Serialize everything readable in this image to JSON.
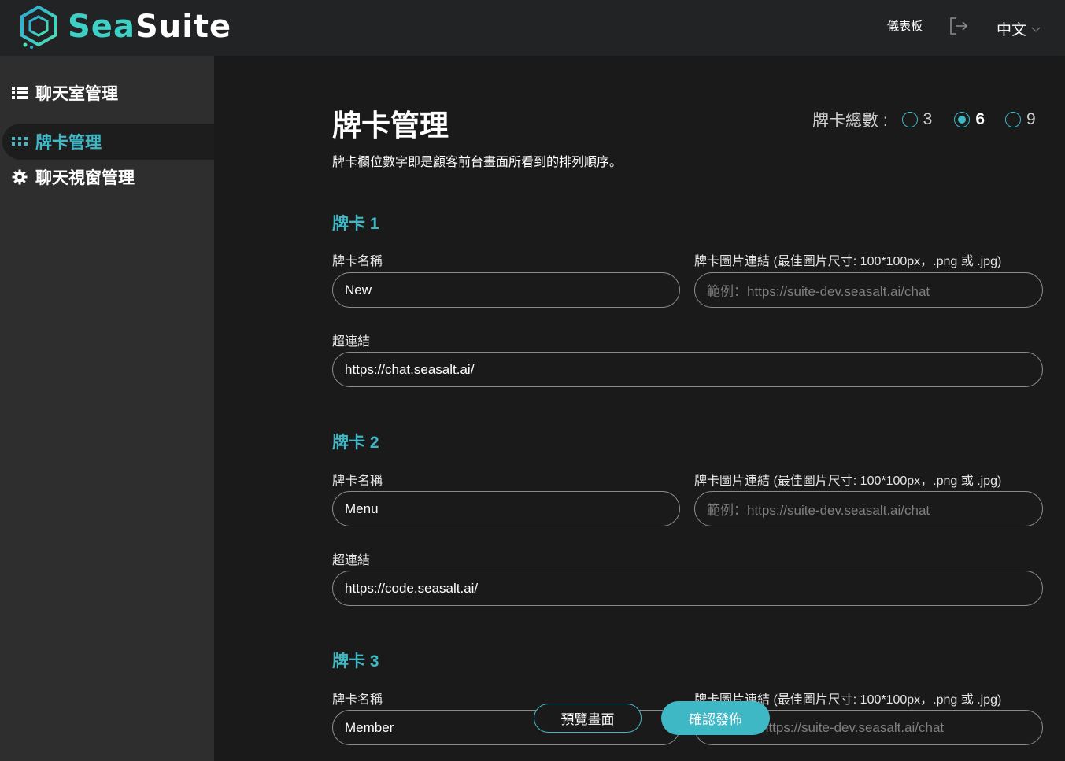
{
  "header": {
    "logo": {
      "part1": "Sea",
      "part2": "Suite"
    },
    "dashboard_link": "儀表板",
    "language": "中文",
    "accent_color": "#3fb8c6",
    "icons": {
      "logout": "logout-icon",
      "language_dropdown": "chevron-down-icon"
    }
  },
  "sidebar": {
    "items": [
      {
        "label": "聊天室管理",
        "icon": "list-icon",
        "active": false
      },
      {
        "label": "牌卡管理",
        "icon": "grid-icon",
        "active": true
      },
      {
        "label": "聊天視窗管理",
        "icon": "gear-icon",
        "active": false
      }
    ]
  },
  "main": {
    "title": "牌卡管理",
    "subtitle": "牌卡欄位數字即是顧客前台畫面所看到的排列順序。",
    "total": {
      "label": "牌卡總數 :",
      "options": [
        "3",
        "6",
        "9"
      ],
      "selected": "6"
    },
    "cards": [
      {
        "title": "牌卡 1",
        "name_label": "牌卡名稱",
        "name_value": "New",
        "image_label": "牌卡圖片連結 (最佳圖片尺寸: 100*100px，.png 或 .jpg)",
        "image_placeholder": "範例：https://suite-dev.seasalt.ai/chat",
        "link_label": "超連結",
        "link_value": "https://chat.seasalt.ai/"
      },
      {
        "title": "牌卡 2",
        "name_label": "牌卡名稱",
        "name_value": "Menu",
        "image_label": "牌卡圖片連結 (最佳圖片尺寸: 100*100px，.png 或 .jpg)",
        "image_placeholder": "範例：https://suite-dev.seasalt.ai/chat",
        "link_label": "超連結",
        "link_value": "https://code.seasalt.ai/"
      },
      {
        "title": "牌卡 3",
        "name_label": "牌卡名稱",
        "name_value": "Member",
        "image_label": "牌卡圖片連結 (最佳圖片尺寸: 100*100px，.png 或 .jpg)",
        "image_placeholder": "https://suite-dev.seasalt.ai/chat"
      }
    ],
    "buttons": {
      "preview": "預覽畫面",
      "publish": "確認發佈"
    }
  }
}
